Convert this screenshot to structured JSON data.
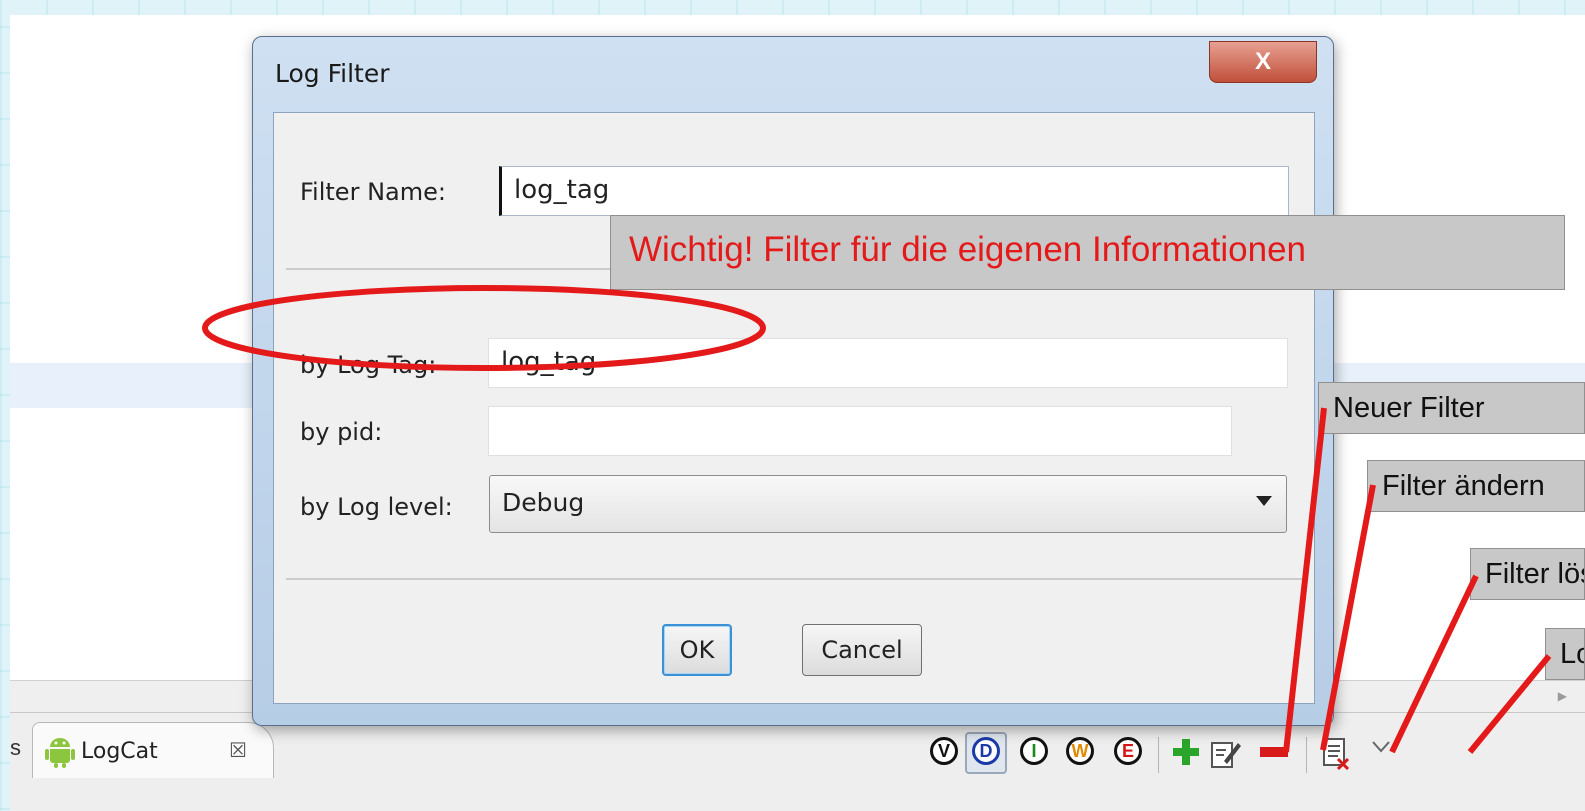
{
  "dialog": {
    "title": "Log Filter",
    "close_label": "X",
    "filter_name_label": "Filter Name:",
    "filter_name_value": "log_tag",
    "log_tag_label": "by Log Tag:",
    "log_tag_value": "log_tag",
    "pid_label": "by pid:",
    "pid_value": "",
    "log_level_label": "by Log level:",
    "log_level_value": "Debug",
    "ok_label": "OK",
    "cancel_label": "Cancel"
  },
  "annotations": {
    "important": "Wichtig! Filter für die eigenen Informationen",
    "new_filter": "Neuer Filter",
    "edit_filter": "Filter ändern",
    "delete_filter": "Filter löschen",
    "clear_log": "Log löschen",
    "annotation_color": "#e41a1a"
  },
  "tabbar": {
    "prev_tab_fragment": "s",
    "tab_label": "LogCat",
    "tab_close": "☒",
    "levels": [
      {
        "letter": "V",
        "color": "#111111"
      },
      {
        "letter": "D",
        "color": "#1a3aa8"
      },
      {
        "letter": "I",
        "color": "#1a8a1a"
      },
      {
        "letter": "W",
        "color": "#e08a00"
      },
      {
        "letter": "E",
        "color": "#d01818"
      }
    ],
    "menu_icon": "chevron-down-icon"
  }
}
